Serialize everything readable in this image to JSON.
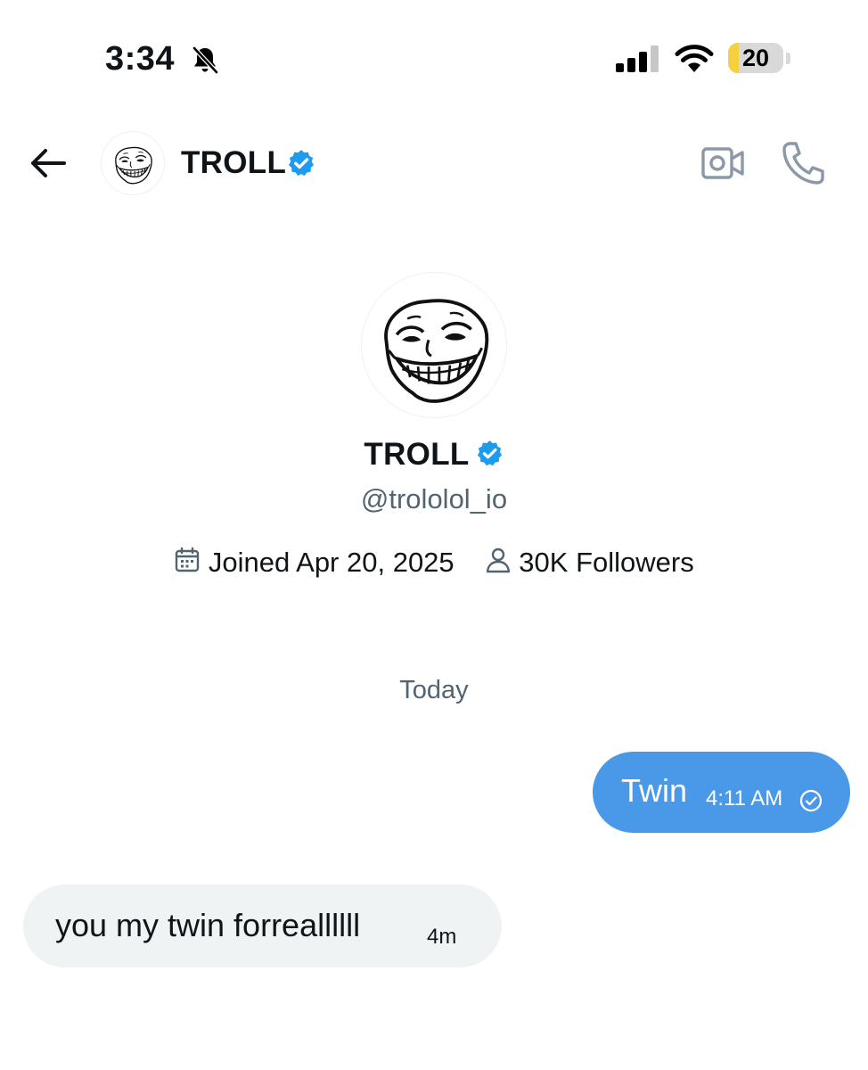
{
  "status_bar": {
    "time": "3:34",
    "battery_level": "20",
    "battery_fraction": 0.2,
    "icons": [
      "bell-slash-icon",
      "cellular-signal-icon",
      "wifi-icon",
      "battery-icon"
    ]
  },
  "header": {
    "name": "TROLL",
    "verified": true,
    "icons": [
      "back-arrow-icon",
      "video-camera-icon",
      "phone-icon"
    ]
  },
  "profile": {
    "name": "TROLL",
    "handle": "@trololol_io",
    "joined": "Joined Apr 20, 2025",
    "followers": "30K Followers",
    "icons": [
      "calendar-icon",
      "person-icon",
      "verified-badge-icon"
    ]
  },
  "messages": {
    "date_divider": "Today",
    "items": [
      {
        "direction": "sent",
        "text": "Twin",
        "time": "4:11 AM",
        "status_icon": "delivered-check-icon"
      },
      {
        "direction": "received",
        "text": "you my twin forreallllll",
        "time": "4m"
      }
    ]
  },
  "colors": {
    "sent_bubble": "#4a99e9",
    "received_bubble": "#eff3f4",
    "verified_badge": "#1d9bf0",
    "secondary_text": "#536471",
    "battery_fill": "#f6cf3f"
  }
}
